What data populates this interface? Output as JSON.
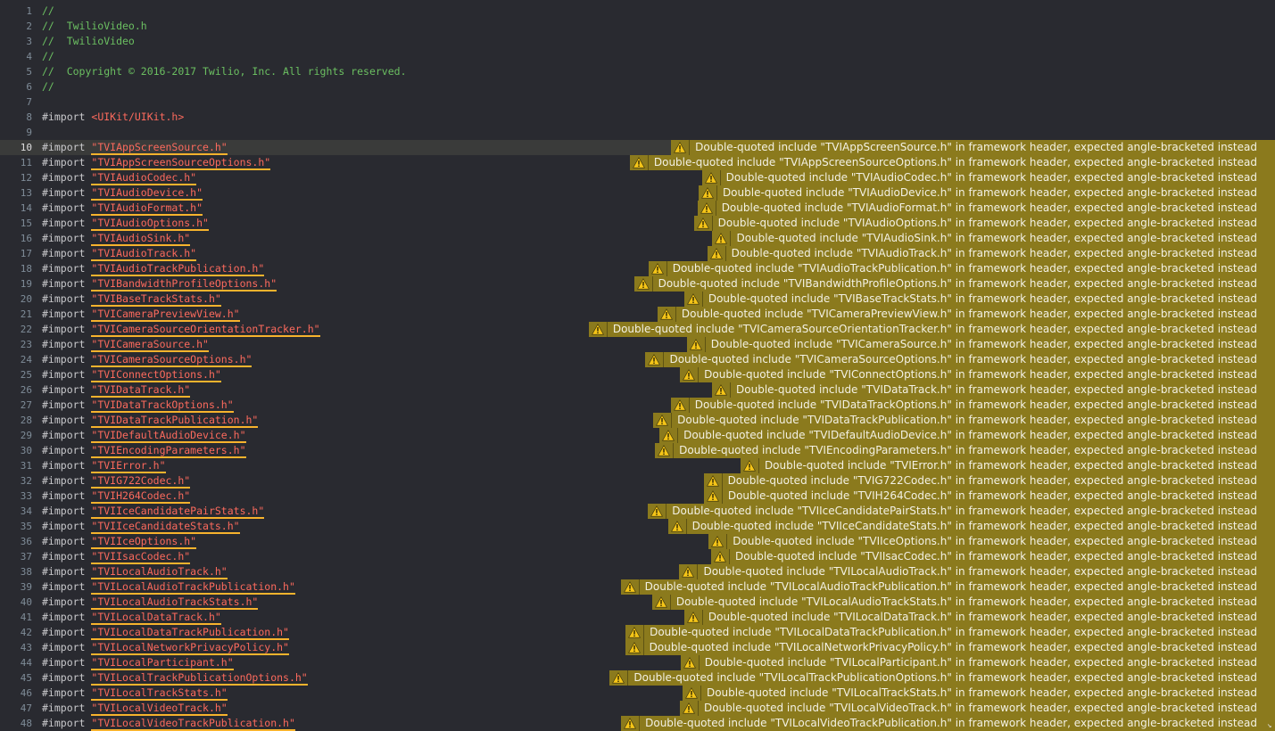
{
  "file": {
    "header_lines": [
      {
        "n": "1",
        "text": "//"
      },
      {
        "n": "2",
        "text": "//  TwilioVideo.h"
      },
      {
        "n": "3",
        "text": "//  TwilioVideo"
      },
      {
        "n": "4",
        "text": "//"
      },
      {
        "n": "5",
        "text": "//  Copyright © 2016-2017 Twilio, Inc. All rights reserved."
      },
      {
        "n": "6",
        "text": "//"
      },
      {
        "n": "7",
        "text": ""
      },
      {
        "n": "8",
        "keyword": "#import",
        "path": "<UIKit/UIKit.h>"
      },
      {
        "n": "9",
        "text": ""
      }
    ],
    "import_keyword": "#import",
    "current_line": "10",
    "warning_prefix": "Double-quoted include",
    "warning_suffix": "in framework header, expected angle-bracketed instead",
    "imports": [
      {
        "n": "10",
        "path": "\"TVIAppScreenSource.h\""
      },
      {
        "n": "11",
        "path": "\"TVIAppScreenSourceOptions.h\""
      },
      {
        "n": "12",
        "path": "\"TVIAudioCodec.h\""
      },
      {
        "n": "13",
        "path": "\"TVIAudioDevice.h\""
      },
      {
        "n": "14",
        "path": "\"TVIAudioFormat.h\""
      },
      {
        "n": "15",
        "path": "\"TVIAudioOptions.h\""
      },
      {
        "n": "16",
        "path": "\"TVIAudioSink.h\""
      },
      {
        "n": "17",
        "path": "\"TVIAudioTrack.h\""
      },
      {
        "n": "18",
        "path": "\"TVIAudioTrackPublication.h\""
      },
      {
        "n": "19",
        "path": "\"TVIBandwidthProfileOptions.h\""
      },
      {
        "n": "20",
        "path": "\"TVIBaseTrackStats.h\""
      },
      {
        "n": "21",
        "path": "\"TVICameraPreviewView.h\""
      },
      {
        "n": "22",
        "path": "\"TVICameraSourceOrientationTracker.h\""
      },
      {
        "n": "23",
        "path": "\"TVICameraSource.h\""
      },
      {
        "n": "24",
        "path": "\"TVICameraSourceOptions.h\""
      },
      {
        "n": "25",
        "path": "\"TVIConnectOptions.h\""
      },
      {
        "n": "26",
        "path": "\"TVIDataTrack.h\""
      },
      {
        "n": "27",
        "path": "\"TVIDataTrackOptions.h\""
      },
      {
        "n": "28",
        "path": "\"TVIDataTrackPublication.h\""
      },
      {
        "n": "29",
        "path": "\"TVIDefaultAudioDevice.h\""
      },
      {
        "n": "30",
        "path": "\"TVIEncodingParameters.h\""
      },
      {
        "n": "31",
        "path": "\"TVIError.h\""
      },
      {
        "n": "32",
        "path": "\"TVIG722Codec.h\""
      },
      {
        "n": "33",
        "path": "\"TVIH264Codec.h\""
      },
      {
        "n": "34",
        "path": "\"TVIIceCandidatePairStats.h\""
      },
      {
        "n": "35",
        "path": "\"TVIIceCandidateStats.h\""
      },
      {
        "n": "36",
        "path": "\"TVIIceOptions.h\""
      },
      {
        "n": "37",
        "path": "\"TVIIsacCodec.h\""
      },
      {
        "n": "38",
        "path": "\"TVILocalAudioTrack.h\""
      },
      {
        "n": "39",
        "path": "\"TVILocalAudioTrackPublication.h\""
      },
      {
        "n": "40",
        "path": "\"TVILocalAudioTrackStats.h\""
      },
      {
        "n": "41",
        "path": "\"TVILocalDataTrack.h\""
      },
      {
        "n": "42",
        "path": "\"TVILocalDataTrackPublication.h\""
      },
      {
        "n": "43",
        "path": "\"TVILocalNetworkPrivacyPolicy.h\""
      },
      {
        "n": "44",
        "path": "\"TVILocalParticipant.h\""
      },
      {
        "n": "45",
        "path": "\"TVILocalTrackPublicationOptions.h\""
      },
      {
        "n": "46",
        "path": "\"TVILocalTrackStats.h\""
      },
      {
        "n": "47",
        "path": "\"TVILocalVideoTrack.h\""
      },
      {
        "n": "48",
        "path": "\"TVILocalVideoTrackPublication.h\""
      }
    ]
  },
  "icons": {
    "warning": "warning-triangle-icon"
  },
  "colors": {
    "background": "#292a30",
    "comment": "#6bbf61",
    "string": "#fc6a5d",
    "warning_banner": "#8b7a1d",
    "warning_icon": "#f5c518"
  }
}
